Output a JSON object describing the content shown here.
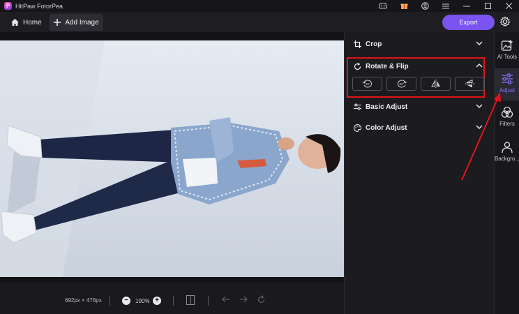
{
  "window": {
    "title": "HitPaw FotorPea",
    "logo_letter": "P"
  },
  "titlebar_icons": [
    "discord-icon",
    "gift-icon",
    "account-icon",
    "menu-icon",
    "minimize-icon",
    "maximize-icon",
    "close-icon"
  ],
  "toolbar": {
    "home_label": "Home",
    "add_image_label": "Add Image",
    "export_label": "Export"
  },
  "canvas": {
    "dimensions": "692px × 476px",
    "zoom": "100%"
  },
  "panel": {
    "sections": [
      {
        "label": "Crop",
        "icon": "crop-icon",
        "expanded": false
      },
      {
        "label": "Rotate & Flip",
        "icon": "rotate-icon",
        "expanded": true,
        "highlighted": true,
        "buttons": [
          {
            "icon": "rotate-left-90-icon",
            "label": "90°"
          },
          {
            "icon": "rotate-right-90-icon",
            "label": "90°"
          },
          {
            "icon": "flip-horizontal-icon"
          },
          {
            "icon": "flip-vertical-icon"
          }
        ]
      },
      {
        "label": "Basic Adjust",
        "icon": "sliders-icon",
        "expanded": false
      },
      {
        "label": "Color Adjust",
        "icon": "palette-icon",
        "expanded": false
      }
    ]
  },
  "rail": [
    {
      "label": "AI Tools",
      "icon": "ai-tools-icon",
      "active": false
    },
    {
      "label": "Adjust",
      "icon": "adjust-icon",
      "active": true
    },
    {
      "label": "Filters",
      "icon": "filters-icon",
      "active": false
    },
    {
      "label": "Backgro...",
      "icon": "background-icon",
      "active": false
    }
  ],
  "colors": {
    "accent": "#7a53f0",
    "highlight": "#e0141a",
    "active_label": "#8b6cff"
  }
}
